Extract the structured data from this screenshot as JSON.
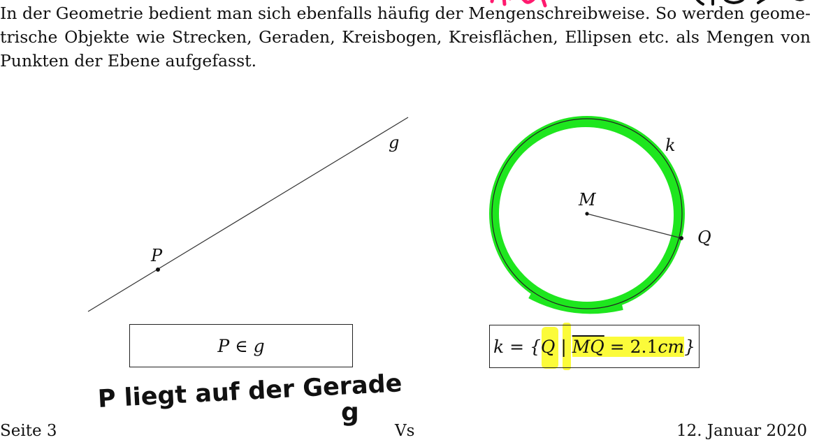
{
  "paragraph": {
    "line1": "In der Geometrie bedient man sich ebenfalls häufig der Mengenschreibweise. So werden geome-",
    "line2": "trische Objekte wie Strecken, Geraden, Kreisbogen, Kreisflächen, Ellipsen etc. als Mengen von",
    "line3": "Punkten der Ebene aufgefasst."
  },
  "figure_line": {
    "point_label": "P",
    "line_label": "g",
    "formula": "P ∈ g"
  },
  "figure_circle": {
    "circle_label": "k",
    "center_label": "M",
    "point_label": "Q",
    "formula": {
      "lhs": "k = {",
      "var": "Q",
      "sep": " | ",
      "segment": "MQ",
      "rhs": " = 2.1",
      "unit": "cm",
      "close": "}"
    }
  },
  "handwriting": {
    "note": "P liegt auf der Gerade",
    "g": "g"
  },
  "footer": {
    "left": "Seite 3",
    "center": "Vs",
    "right": "12. Januar 2020"
  },
  "colors": {
    "highlight_green": "#1ee61e",
    "highlight_yellow": "#fbfb3a",
    "ink_pink": "#ff1a6e"
  }
}
